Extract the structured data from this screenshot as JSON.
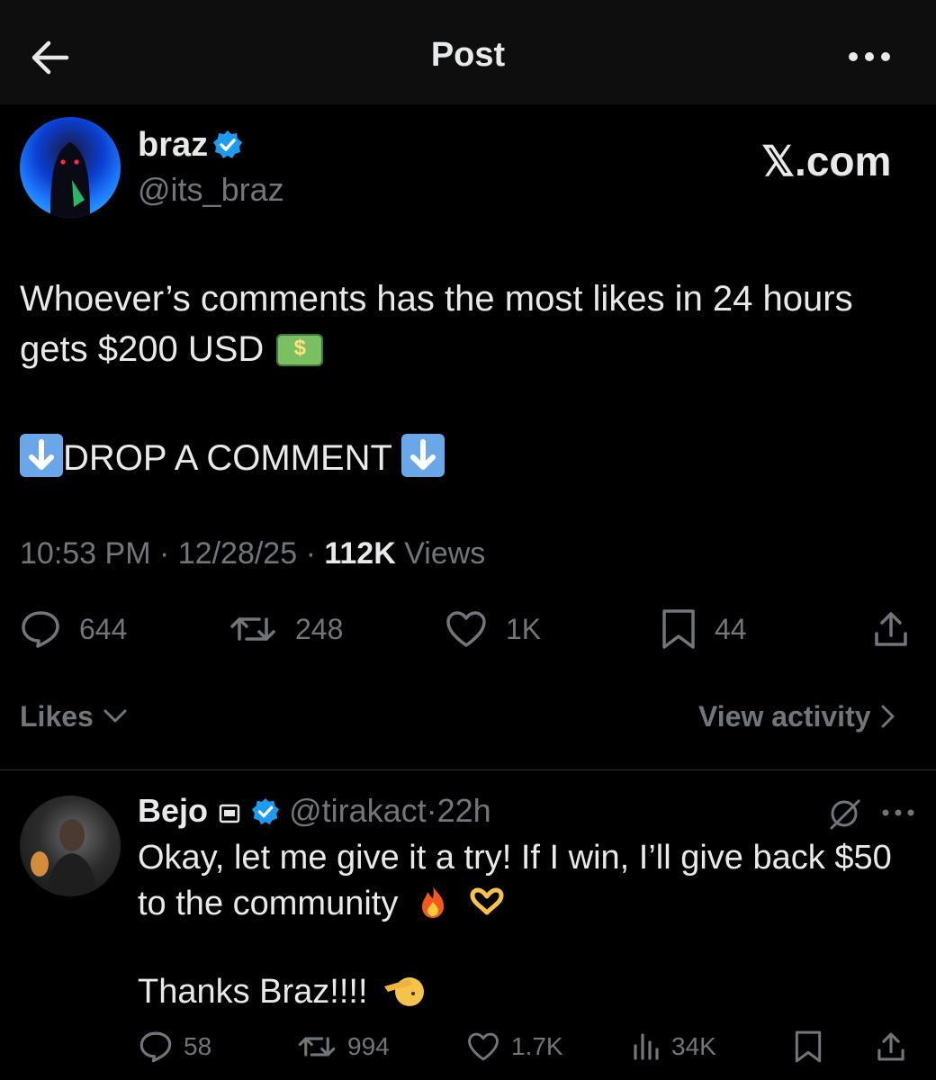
{
  "header": {
    "title": "Post"
  },
  "author": {
    "name": "braz",
    "handle": "@its_braz",
    "watermark": "𝕏.com"
  },
  "post": {
    "line1": "Whoever’s comments has the most likes in 24 hours",
    "line2": "gets $200 USD",
    "line3": "DROP A COMMENT",
    "time": "10:53 PM",
    "date": "12/28/25",
    "views_count": "112K",
    "views_label": "Views",
    "sep": "·"
  },
  "stats": {
    "replies": "644",
    "reposts": "248",
    "likes": "1K",
    "bookmarks": "44"
  },
  "sort": {
    "likes_label": "Likes",
    "view_activity_label": "View activity"
  },
  "reply": {
    "name": "Bejo",
    "handle": "@tirakact",
    "time": "22h",
    "sep": "·",
    "line1": "Okay, let me give it a try! If I win, I’ll give back $50",
    "line2": "to the community",
    "line3": "Thanks Braz!!!!",
    "replies": "58",
    "reposts": "994",
    "likes": "1.7K",
    "views": "34K"
  },
  "colors": {
    "verified": "#1d9bf0",
    "text": "#e7e9ea",
    "muted": "#71767b",
    "background": "#000000"
  },
  "icons": [
    "back-arrow-icon",
    "more-icon",
    "verified-icon",
    "money-icon",
    "down-arrow-icon",
    "reply-icon",
    "repost-icon",
    "like-icon",
    "bookmark-icon",
    "share-icon",
    "chevron-down-icon",
    "chevron-right-icon",
    "grok-icon",
    "views-icon",
    "fire-icon",
    "heart-hands-icon",
    "saluting-face-icon"
  ]
}
